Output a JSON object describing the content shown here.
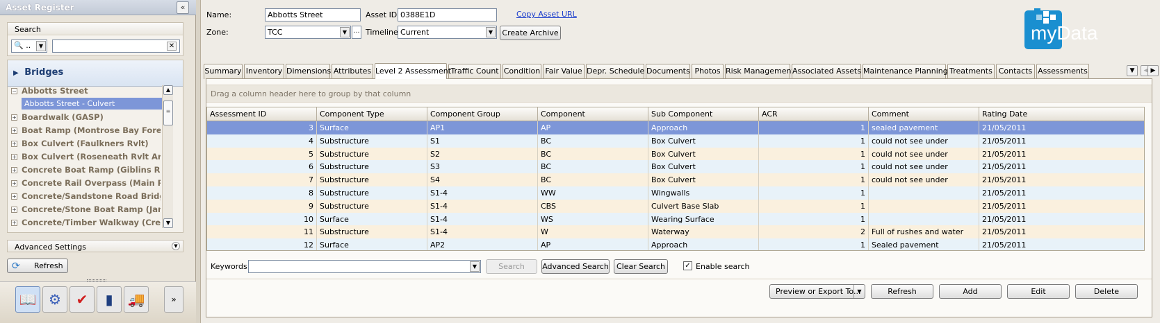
{
  "left": {
    "title": "Asset Register",
    "collapse_icon": "«",
    "search": {
      "heading": "Search",
      "type_value": "..",
      "value": ""
    },
    "category": "Bridges",
    "tree": [
      {
        "label": "Abbotts Street",
        "expanded": true
      },
      {
        "label": "Boardwalk (GASP)"
      },
      {
        "label": "Boat Ramp (Montrose Bay Foreshor..."
      },
      {
        "label": "Box Culvert (Faulkners Rvlt)"
      },
      {
        "label": "Box Culvert (Roseneath Rvlt Arched..."
      },
      {
        "label": "Concrete Boat Ramp (Giblins Reserv..."
      },
      {
        "label": "Concrete Rail Overpass (Main Rd)"
      },
      {
        "label": "Concrete/Sandstone Road Bridge (H..."
      },
      {
        "label": "Concrete/Stone Boat Ramp (Jams A..."
      },
      {
        "label": "Concrete/Timber Walkway (Creek R..."
      }
    ],
    "selected_child": "Abbotts Street - Culvert",
    "advanced_settings": "Advanced Settings",
    "refresh_label": "Refresh",
    "modules": [
      "register-module-icon",
      "settings-module-icon",
      "checklist-module-icon",
      "book-module-icon",
      "truck-module-icon"
    ]
  },
  "form": {
    "name_label": "Name:",
    "name_value": "Abbotts Street",
    "asset_id_label": "Asset ID:",
    "asset_id_value": "0388E1D",
    "copy_link": "Copy Asset URL",
    "zone_label": "Zone:",
    "zone_value": "TCC",
    "timeline_label": "Timeline:",
    "timeline_value": "Current",
    "create_archive": "Create Archive"
  },
  "logo": {
    "text": "myData",
    "color": "#1a8fd0"
  },
  "tabs": [
    {
      "label": "Summary",
      "w": 56
    },
    {
      "label": "Inventory",
      "w": 58
    },
    {
      "label": "Dimensions",
      "w": 64
    },
    {
      "label": "Attributes",
      "w": 60
    },
    {
      "label": "Level 2 Assessment",
      "w": 104,
      "active": true
    },
    {
      "label": "Traffic Count",
      "w": 76
    },
    {
      "label": "Condition",
      "w": 56
    },
    {
      "label": "Fair Value",
      "w": 60
    },
    {
      "label": "Depr. Schedule",
      "w": 84
    },
    {
      "label": "Documents",
      "w": 64
    },
    {
      "label": "Photos",
      "w": 46
    },
    {
      "label": "Risk Management",
      "w": 94
    },
    {
      "label": "Associated Assets",
      "w": 100
    },
    {
      "label": "Maintenance Planning",
      "w": 120
    },
    {
      "label": "Treatments",
      "w": 68
    },
    {
      "label": "Contacts",
      "w": 56
    },
    {
      "label": "Assessments",
      "w": 76
    }
  ],
  "grid": {
    "group_hint": "Drag a column header here to group by that column",
    "columns": [
      "Assessment ID",
      "Component Type",
      "Component Group",
      "Component",
      "Sub Component",
      "ACR",
      "Comment",
      "Rating Date"
    ],
    "rows": [
      [
        "3",
        "Surface",
        "AP1",
        "AP",
        "Approach",
        "1",
        "sealed pavement",
        "21/05/2011"
      ],
      [
        "4",
        "Substructure",
        "S1",
        "BC",
        "Box Culvert",
        "1",
        "could not see under",
        "21/05/2011"
      ],
      [
        "5",
        "Substructure",
        "S2",
        "BC",
        "Box Culvert",
        "1",
        "could not see under",
        "21/05/2011"
      ],
      [
        "6",
        "Substructure",
        "S3",
        "BC",
        "Box Culvert",
        "1",
        "could not see under",
        "21/05/2011"
      ],
      [
        "7",
        "Substructure",
        "S4",
        "BC",
        "Box Culvert",
        "1",
        "could not see under",
        "21/05/2011"
      ],
      [
        "8",
        "Substructure",
        "S1-4",
        "WW",
        "Wingwalls",
        "1",
        "",
        "21/05/2011"
      ],
      [
        "9",
        "Substructure",
        "S1-4",
        "CBS",
        "Culvert Base Slab",
        "1",
        "",
        "21/05/2011"
      ],
      [
        "10",
        "Surface",
        "S1-4",
        "WS",
        "Wearing Surface",
        "1",
        "",
        "21/05/2011"
      ],
      [
        "11",
        "Substructure",
        "S1-4",
        "W",
        "Waterway",
        "2",
        "Full of rushes and water",
        "21/05/2011"
      ],
      [
        "12",
        "Surface",
        "AP2",
        "AP",
        "Approach",
        "1",
        "Sealed pavement",
        "21/05/2011"
      ]
    ]
  },
  "search_bar": {
    "keywords_label": "Keywords:",
    "keywords_value": "",
    "search": "Search",
    "advanced_search": "Advanced Search",
    "clear_search": "Clear Search",
    "enable_search": "Enable search",
    "enable_checked": true
  },
  "actions": {
    "preview_export": "Preview or Export To...",
    "refresh": "Refresh",
    "add": "Add",
    "edit": "Edit",
    "delete": "Delete"
  }
}
